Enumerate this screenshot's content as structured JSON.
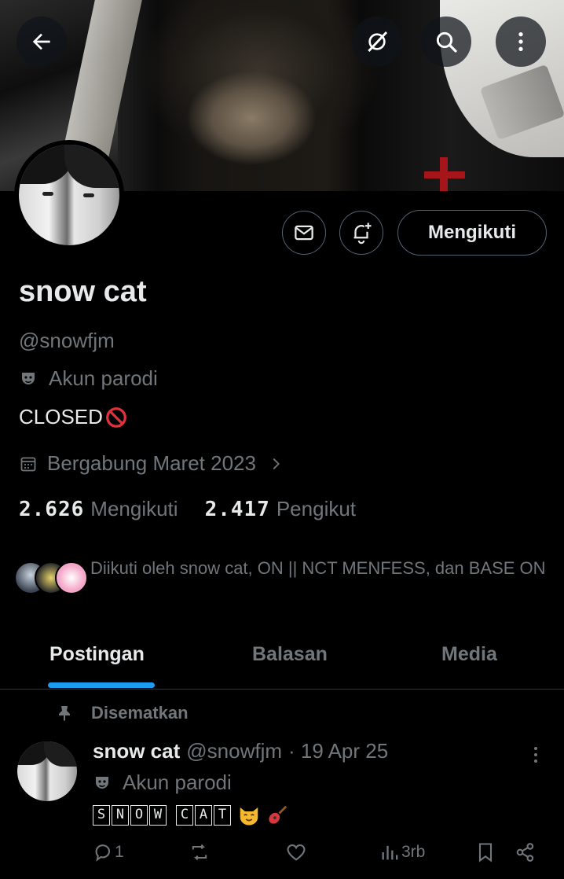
{
  "header": {
    "back_icon": "arrow-left-icon",
    "grok_icon": "grok-icon",
    "search_icon": "search-icon",
    "more_icon": "more-vertical-icon"
  },
  "profile": {
    "name": "snow cat",
    "handle": "@snowfjm",
    "parody_label": "Akun parodi",
    "bio": "CLOSED",
    "joined": "Bergabung Maret 2023",
    "following_count": "2.626",
    "following_label": "Mengikuti",
    "followers_count": "2.417",
    "followers_label": "Pengikut"
  },
  "actions": {
    "message_icon": "mail-icon",
    "notify_icon": "bell-plus-icon",
    "follow_label": "Mengikuti"
  },
  "followed_by": {
    "text": "Diikuti oleh snow cat, ON || NCT MENFESS, dan BASE ON"
  },
  "tabs": [
    {
      "label": "Postingan",
      "active": true
    },
    {
      "label": "Balasan",
      "active": false
    },
    {
      "label": "Media",
      "active": false
    }
  ],
  "post": {
    "pinned_label": "Disematkan",
    "author_name": "snow cat",
    "author_handle": "@snowfjm",
    "date": "· 19 Apr 25",
    "parody_label": "Akun parodi",
    "text": "SNOW CAT",
    "reply_count": "1",
    "retweet_count": "",
    "like_count": "",
    "views": "3rb"
  },
  "colors": {
    "background": "#000000",
    "text_primary": "#e7e9ea",
    "text_secondary": "#71767b",
    "accent": "#1d9bf0",
    "border": "#2f3336"
  }
}
